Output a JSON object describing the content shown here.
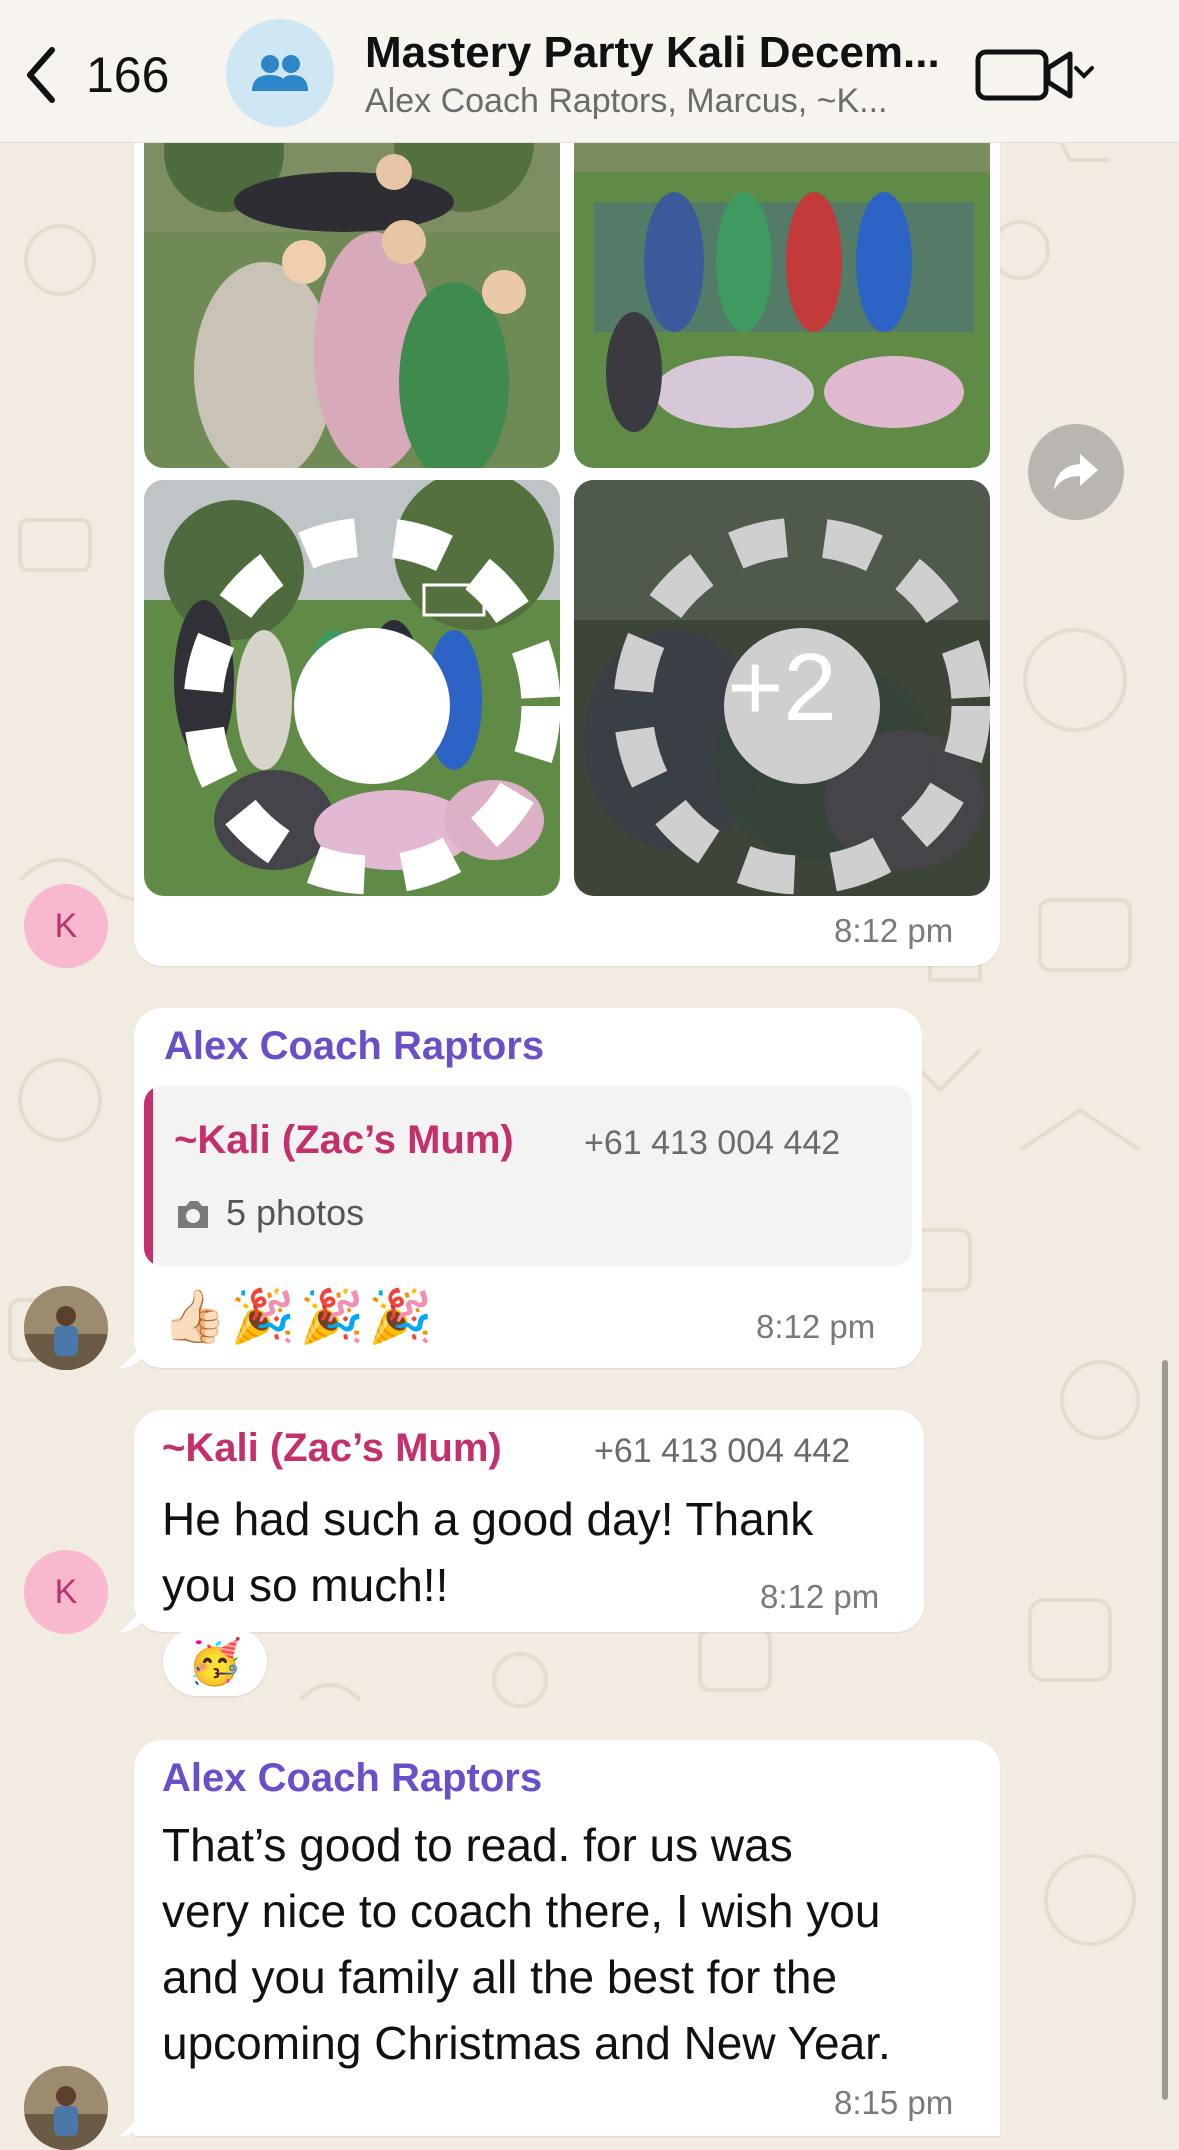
{
  "header": {
    "back_count": "166",
    "title": "Mastery Party Kali Decem...",
    "subtitle": "Alex Coach Raptors, Marcus, ~K..."
  },
  "album": {
    "more_count": "+2",
    "time": "8:12 pm"
  },
  "reply_message": {
    "sender": "Alex Coach Raptors",
    "quoted_sender": "~Kali (Zac’s Mum)",
    "quoted_phone": "+61 413 004 442",
    "quoted_text": "5 photos",
    "emoji_text": "👍🏻🎉🎉🎉",
    "time": "8:12 pm"
  },
  "kali_message": {
    "sender": "~Kali (Zac’s Mum)",
    "phone": "+61 413 004 442",
    "text_line1": "He had such a good day! Thank",
    "text_line2": "you so much!!",
    "time": "8:12 pm",
    "reaction": "🥳"
  },
  "alex_message": {
    "sender": "Alex Coach Raptors",
    "line1": "That’s good to read. for us was",
    "line2": "very nice to coach there, I wish you",
    "line3": "and you family all the best for the",
    "line4": "upcoming Christmas and New Year.",
    "time": "8:15 pm"
  },
  "avatar_initial": "K",
  "colors": {
    "sender_blue": "#6a4fc8",
    "sender_pink": "#c4306b",
    "background": "#f1ebe2"
  }
}
